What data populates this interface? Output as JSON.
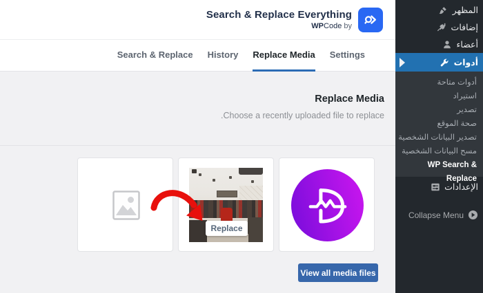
{
  "header": {
    "title": "Search & Replace Everything",
    "brand_bold": "WP",
    "brand_rest": "Code",
    "by_label": "by ",
    "logo_color": "#2968f3"
  },
  "tabs": [
    {
      "label": "Search & Replace",
      "active": false
    },
    {
      "label": "History",
      "active": false
    },
    {
      "label": "Replace Media",
      "active": true
    },
    {
      "label": "Settings",
      "active": false
    }
  ],
  "content": {
    "heading": "Replace Media",
    "subtitle": "Choose a recently uploaded file to replace.",
    "replace_button_label": "Replace",
    "view_all_button_label": "View all media files",
    "tiles": [
      {
        "type": "placeholder",
        "icon": "image-placeholder-icon"
      },
      {
        "type": "photo",
        "description": "clothing store photo thumbnail"
      },
      {
        "type": "logo",
        "description": "purple circular wave logo"
      }
    ]
  },
  "sidebar": {
    "top_items": [
      {
        "label": "المظهر",
        "icon": "brush-icon",
        "active": false
      },
      {
        "label": "إضافات",
        "icon": "plugin-icon",
        "active": false
      },
      {
        "label": "أعضاء",
        "icon": "users-icon",
        "active": false
      },
      {
        "label": "أدوات",
        "icon": "wrench-icon",
        "active": true
      }
    ],
    "submenu": [
      "أدوات متاحة",
      "استيراد",
      "تصدير",
      "صحة الموقع",
      "تصدير البيانات الشخصية",
      "مسح البيانات الشخصية",
      "WP Search & Replace"
    ],
    "submenu_current": "WP Search & Replace",
    "settings_label": "الإعدادات",
    "collapse_label": "Collapse Menu"
  },
  "colors": {
    "menu_highlight": "#2271b1",
    "tab_underline": "#2c6cb5",
    "view_all_button": "#3767ab",
    "logo_blue": "#2968f3",
    "arrow_red": "#e8100c",
    "logo_gradient": [
      "#7b0ddc",
      "#c816ee"
    ],
    "sidebar_bg": "#23282d",
    "submenu_bg": "#32373c",
    "content_bg": "#f1f1f3"
  }
}
